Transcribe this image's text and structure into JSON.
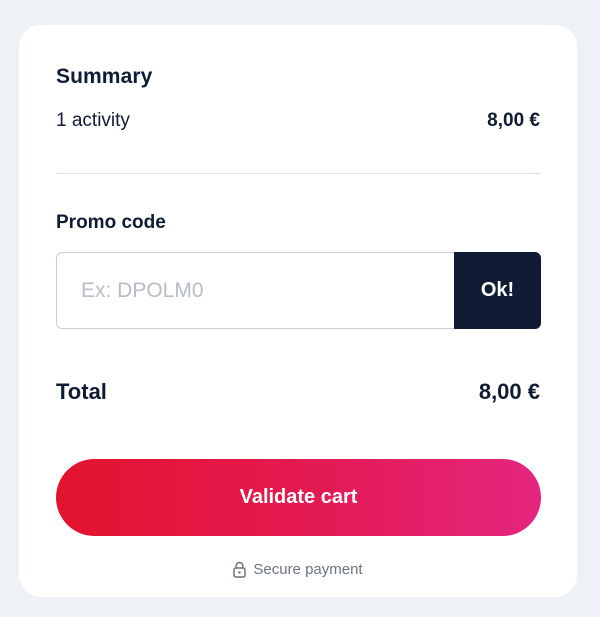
{
  "summary": {
    "title": "Summary",
    "activity_label": "1 activity",
    "activity_price": "8,00 €"
  },
  "promo": {
    "label": "Promo code",
    "placeholder": "Ex: DPOLM0",
    "value": "",
    "button_label": "Ok!"
  },
  "total": {
    "label": "Total",
    "amount": "8,00 €"
  },
  "validate": {
    "button_label": "Validate cart"
  },
  "secure": {
    "text": "Secure payment",
    "icon": "lock-icon"
  },
  "colors": {
    "page_background": "#eef2f7",
    "card_background": "#ffffff",
    "text_primary": "#0f1c33",
    "ok_button": "#0f1c33",
    "validate_gradient_start": "#e2142d",
    "validate_gradient_end": "#e5267f",
    "muted_text": "#6b7380"
  }
}
